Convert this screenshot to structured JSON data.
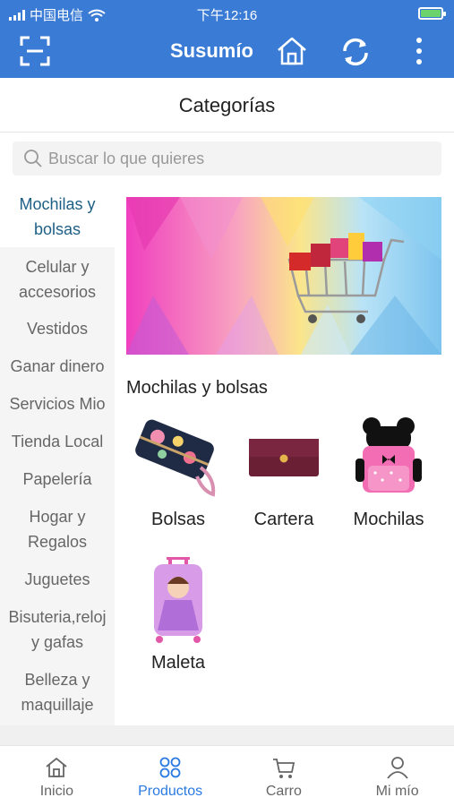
{
  "status_bar": {
    "carrier": "中国电信",
    "time": "下午12:16"
  },
  "app": {
    "title": "Susumío"
  },
  "header": {
    "title": "Categorías"
  },
  "search": {
    "placeholder": "Buscar lo que quieres"
  },
  "sidebar": {
    "items": [
      {
        "label": "Mochilas y bolsas",
        "active": true
      },
      {
        "label": "Celular y accesorios",
        "active": false
      },
      {
        "label": "Vestidos",
        "active": false
      },
      {
        "label": "Ganar dinero",
        "active": false
      },
      {
        "label": "Servicios Mio",
        "active": false
      },
      {
        "label": "Tienda Local",
        "active": false
      },
      {
        "label": "Papelería",
        "active": false
      },
      {
        "label": "Hogar y Regalos",
        "active": false
      },
      {
        "label": "Juguetes",
        "active": false
      },
      {
        "label": "Bisuteria,reloj y gafas",
        "active": false
      },
      {
        "label": "Belleza y maquillaje",
        "active": false
      }
    ]
  },
  "content": {
    "section_title": "Mochilas y bolsas",
    "products": [
      {
        "label": "Bolsas",
        "icon": "floral-wallet-image"
      },
      {
        "label": "Cartera",
        "icon": "maroon-clutch-image"
      },
      {
        "label": "Mochilas",
        "icon": "pink-backpack-image"
      },
      {
        "label": "Maleta",
        "icon": "princess-suitcase-image"
      }
    ]
  },
  "tabbar": {
    "tabs": [
      {
        "label": "Inicio",
        "icon": "home-icon",
        "active": false
      },
      {
        "label": "Productos",
        "icon": "grid-icon",
        "active": true
      },
      {
        "label": "Carro",
        "icon": "cart-icon",
        "active": false
      },
      {
        "label": "Mi mío",
        "icon": "user-icon",
        "active": false
      }
    ]
  },
  "colors": {
    "primary": "#3a7bd5",
    "active_tab": "#2a7ae2",
    "active_category": "#1e5f85"
  }
}
